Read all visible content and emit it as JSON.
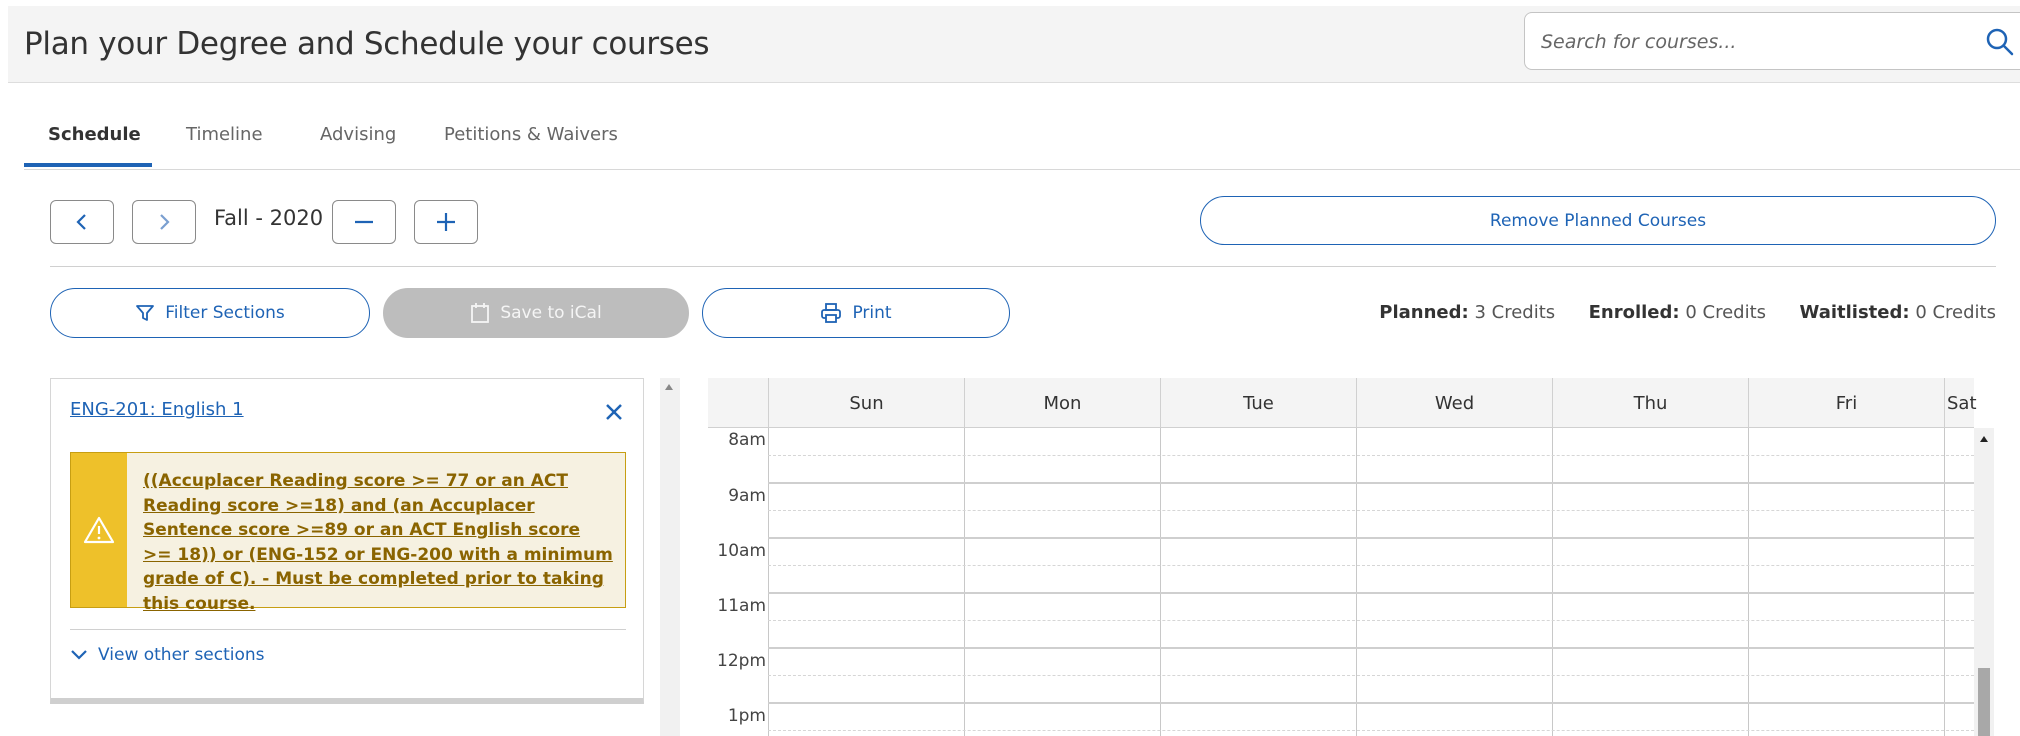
{
  "header": {
    "title": "Plan your Degree and Schedule your courses",
    "search_placeholder": "Search for courses..."
  },
  "tabs": [
    {
      "label": "Schedule",
      "active": true
    },
    {
      "label": "Timeline",
      "active": false
    },
    {
      "label": "Advising",
      "active": false
    },
    {
      "label": "Petitions & Waivers",
      "active": false
    }
  ],
  "term_nav": {
    "term": "Fall - 2020",
    "prev_icon": "chevron-left-icon",
    "next_icon": "chevron-right-icon",
    "remove_term_icon": "minus-icon",
    "add_term_icon": "plus-icon"
  },
  "actions": {
    "remove_planned": "Remove Planned Courses",
    "filter_sections": "Filter Sections",
    "save_ical": "Save to iCal",
    "print": "Print"
  },
  "credits": {
    "planned_label": "Planned:",
    "planned_value": "3 Credits",
    "enrolled_label": "Enrolled:",
    "enrolled_value": "0 Credits",
    "waitlisted_label": "Waitlisted:",
    "waitlisted_value": "0 Credits"
  },
  "course_card": {
    "course": "ENG-201: English 1",
    "warning": "((Accuplacer Reading score >= 77 or an ACT Reading score >=18) and (an Accuplacer Sentence score >=89 or an ACT English score >= 18)) or (ENG-152 or ENG-200 with a minimum grade of C). - Must be completed prior to taking this course.",
    "view_other": "View other sections"
  },
  "calendar": {
    "days": [
      "Sun",
      "Mon",
      "Tue",
      "Wed",
      "Thu",
      "Fri",
      "Sat"
    ],
    "times": [
      "8am",
      "9am",
      "10am",
      "11am",
      "12pm",
      "1pm"
    ]
  },
  "colors": {
    "accent": "#1e63b5",
    "warning_strip": "#eec12a",
    "warning_bg": "#f6f1e1",
    "warning_text": "#8a6400",
    "disabled": "#bdbdbd"
  }
}
